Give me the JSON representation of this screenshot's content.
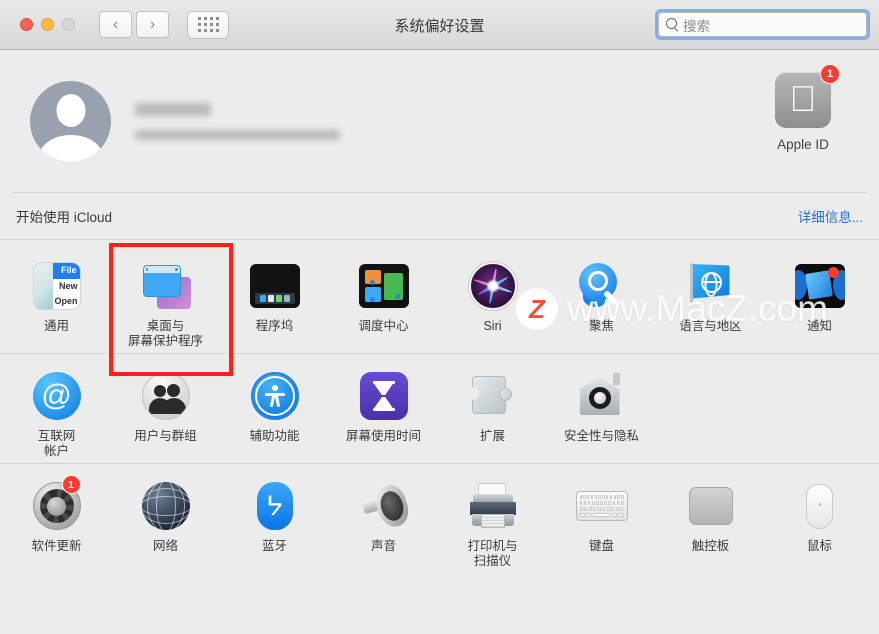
{
  "window": {
    "title": "系统偏好设置",
    "traffic_lights": [
      "close",
      "minimize",
      "zoom-disabled"
    ],
    "nav_back": "‹",
    "nav_forward": "›",
    "grid_button": "show-all-grid"
  },
  "search": {
    "placeholder": "搜索",
    "value": "",
    "focused": true,
    "focus_color": "#84aeea"
  },
  "account": {
    "name_redacted": true,
    "subtitle_redacted": true,
    "apple_id": {
      "label": "Apple ID",
      "badge": "1",
      "badge_color": "#fc3b30"
    }
  },
  "icloud_banner": {
    "text": "开始使用 iCloud",
    "link": "详细信息...",
    "link_color": "#2a6fd4"
  },
  "highlight": {
    "target": "桌面与屏幕保护程序",
    "color": "#ff2116"
  },
  "watermark": {
    "badge": "Z",
    "text": "www.MacZ.com"
  },
  "rows": [
    {
      "items": [
        {
          "label": "通用",
          "icon": "general-icon",
          "badge": null
        },
        {
          "label": "桌面与\n屏幕保护程序",
          "icon": "desktop-screensaver-icon",
          "badge": null
        },
        {
          "label": "程序坞",
          "icon": "dock-icon",
          "badge": null
        },
        {
          "label": "调度中心",
          "icon": "mission-control-icon",
          "badge": null
        },
        {
          "label": "Siri",
          "icon": "siri-icon",
          "badge": null
        },
        {
          "label": "聚焦",
          "icon": "spotlight-icon",
          "badge": null
        },
        {
          "label": "语言与地区",
          "icon": "language-region-icon",
          "badge": null
        },
        {
          "label": "通知",
          "icon": "notifications-icon",
          "badge": null
        }
      ]
    },
    {
      "items": [
        {
          "label": "互联网\n帐户",
          "icon": "internet-accounts-icon",
          "badge": null
        },
        {
          "label": "用户与群组",
          "icon": "users-groups-icon",
          "badge": null
        },
        {
          "label": "辅助功能",
          "icon": "accessibility-icon",
          "badge": null
        },
        {
          "label": "屏幕使用时间",
          "icon": "screen-time-icon",
          "badge": null
        },
        {
          "label": "扩展",
          "icon": "extensions-icon",
          "badge": null
        },
        {
          "label": "安全性与隐私",
          "icon": "security-privacy-icon",
          "badge": null
        }
      ]
    },
    {
      "items": [
        {
          "label": "软件更新",
          "icon": "software-update-icon",
          "badge": "1"
        },
        {
          "label": "网络",
          "icon": "network-icon",
          "badge": null
        },
        {
          "label": "蓝牙",
          "icon": "bluetooth-icon",
          "badge": null
        },
        {
          "label": "声音",
          "icon": "sound-icon",
          "badge": null
        },
        {
          "label": "打印机与\n扫描仪",
          "icon": "printers-scanners-icon",
          "badge": null
        },
        {
          "label": "键盘",
          "icon": "keyboard-icon",
          "badge": null
        },
        {
          "label": "触控板",
          "icon": "trackpad-icon",
          "badge": null
        },
        {
          "label": "鼠标",
          "icon": "mouse-icon",
          "badge": null
        }
      ]
    }
  ]
}
